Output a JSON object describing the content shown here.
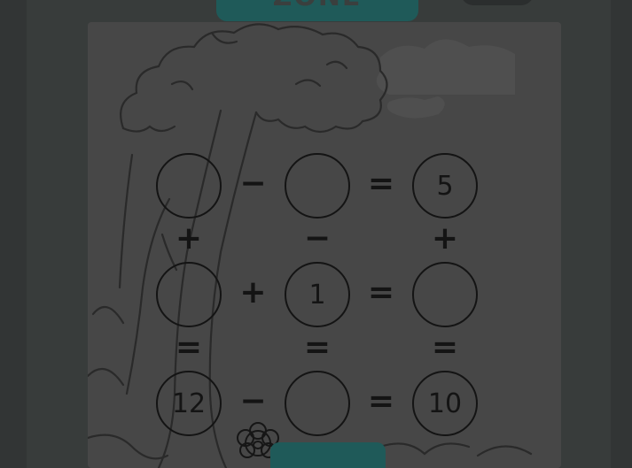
{
  "header": {
    "title_text": "ZONE"
  },
  "puzzle": {
    "rows": [
      {
        "cells": [
          {
            "value": "",
            "filled": false
          },
          {
            "value": "",
            "filled": false
          },
          {
            "value": "5",
            "filled": true
          }
        ],
        "ops": [
          "−",
          "="
        ]
      },
      {
        "cells": [
          {
            "value": "",
            "filled": false
          },
          {
            "value": "1",
            "filled": true
          },
          {
            "value": "",
            "filled": false
          }
        ],
        "ops": [
          "+",
          "="
        ]
      },
      {
        "cells": [
          {
            "value": "12",
            "filled": true
          },
          {
            "value": "",
            "filled": false
          },
          {
            "value": "10",
            "filled": true
          }
        ],
        "ops": [
          "−",
          "="
        ]
      }
    ],
    "column_ops": [
      [
        "+",
        "−",
        "+"
      ],
      [
        "=",
        "=",
        "="
      ]
    ]
  },
  "icons": [
    "flower-icon",
    "tree-icon",
    "cloud-icon"
  ],
  "colors": {
    "background": "#323535",
    "frame": "#383c3b",
    "card": "#474747",
    "teal_accent": "#1f5a59",
    "ink": "#141414"
  }
}
